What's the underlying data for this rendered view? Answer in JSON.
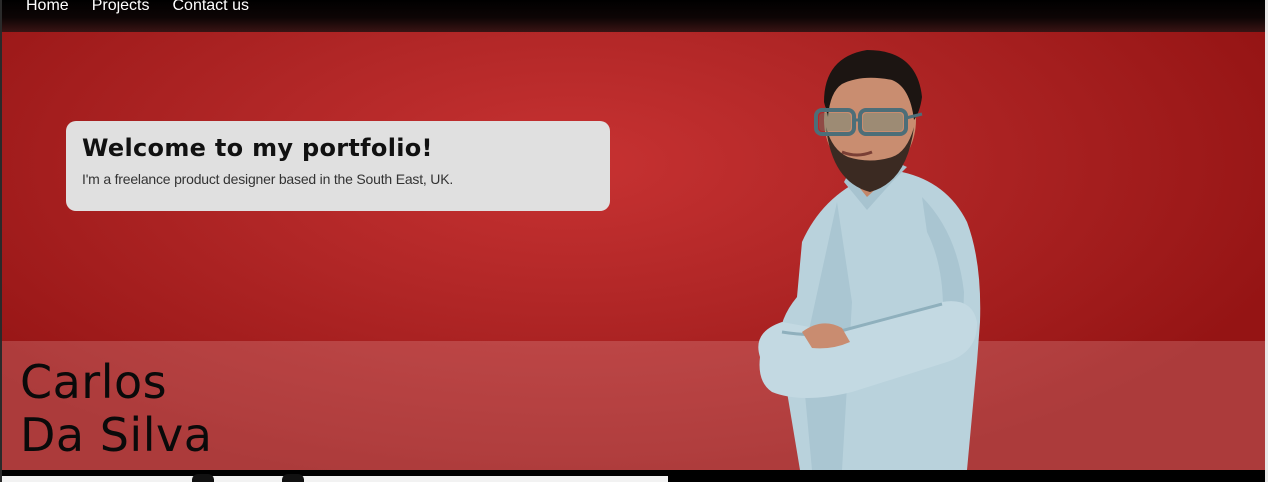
{
  "nav": {
    "items": [
      {
        "label": "Home"
      },
      {
        "label": "Projects"
      },
      {
        "label": "Contact us"
      }
    ]
  },
  "hero": {
    "welcome_title": "Welcome to my portfolio!",
    "welcome_text": "I'm a freelance product designer based in the South East, UK.",
    "name_first": "Carlos",
    "name_last": "Da Silva",
    "portrait_alt": "Portrait of Carlos Da Silva"
  },
  "colors": {
    "hero_red": "#b02626",
    "card_bg": "#e0e0e0",
    "nav_bg": "#000000"
  }
}
